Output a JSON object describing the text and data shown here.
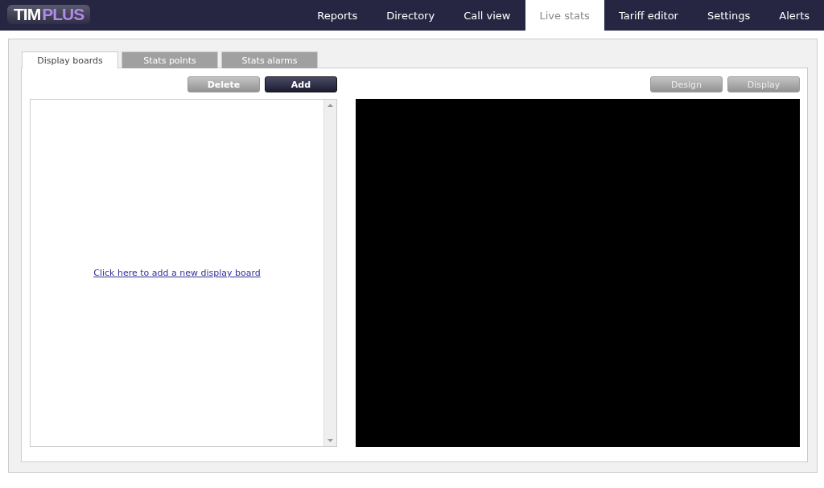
{
  "logo": {
    "first": "TIM",
    "second": "PLUS"
  },
  "nav": [
    {
      "label": "Reports",
      "selected": false
    },
    {
      "label": "Directory",
      "selected": false
    },
    {
      "label": "Call view",
      "selected": false
    },
    {
      "label": "Live stats",
      "selected": true
    },
    {
      "label": "Tariff editor",
      "selected": false
    },
    {
      "label": "Settings",
      "selected": false
    },
    {
      "label": "Alerts",
      "selected": false
    }
  ],
  "tabs": [
    {
      "label": "Display boards",
      "selected": true
    },
    {
      "label": "Stats points",
      "selected": false
    },
    {
      "label": "Stats alarms",
      "selected": false
    }
  ],
  "list_buttons": [
    {
      "label": "Delete",
      "kind": "secondary"
    },
    {
      "label": "Add",
      "kind": "primary"
    }
  ],
  "board_list": {
    "link": "Click here to add a new display board"
  },
  "preview_buttons": [
    {
      "label": "Design",
      "disabled": true
    },
    {
      "label": "Display",
      "disabled": true
    }
  ]
}
